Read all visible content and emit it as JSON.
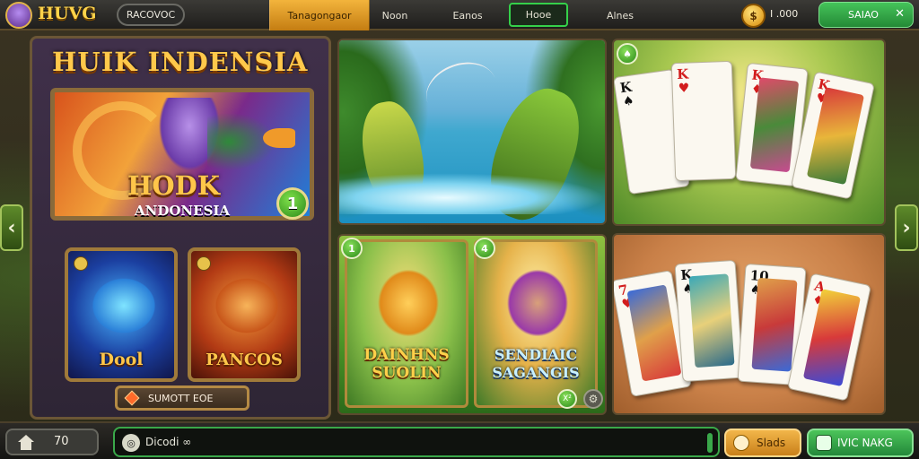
{
  "topbar": {
    "logo_text": "HUVG",
    "left_pill": "RACOVOC",
    "tabs": [
      {
        "label": "Tanagongaor",
        "active": true
      },
      {
        "label": "Noon",
        "active": false
      },
      {
        "label": "Eanos",
        "active": false
      },
      {
        "label": "Hooe",
        "active": false,
        "boxed": true
      },
      {
        "label": "Alnes",
        "active": false
      }
    ],
    "balance": "I .000",
    "deposit_label": "SAIAO",
    "close_glyph": "✕"
  },
  "nav": {
    "prev_glyph": "‹",
    "next_glyph": "›"
  },
  "left_panel": {
    "title": "HUIK INDENSIA",
    "feature_name": "HODK",
    "feature_sub": "ANDONESIA",
    "feature_badge": "1",
    "mini_cards": [
      {
        "label": "Dool",
        "theme": "blue"
      },
      {
        "label": "PANCOS",
        "theme": "red"
      }
    ],
    "select_button": "SUMOTT EOE"
  },
  "tiles": {
    "cards_top_badge": "♠",
    "cards_top": [
      {
        "rank": "K",
        "suit": "♠",
        "ink": "black"
      },
      {
        "rank": "K",
        "suit": "♥",
        "ink": "red"
      },
      {
        "rank": "K",
        "suit": "♦",
        "ink": "red"
      },
      {
        "rank": "K",
        "suit": "♥",
        "ink": "red"
      }
    ],
    "cards_bottom": [
      {
        "rank": "7",
        "suit": "♥",
        "ink": "red"
      },
      {
        "rank": "K",
        "suit": "♠",
        "ink": "black"
      },
      {
        "rank": "10",
        "suit": "♠",
        "ink": "black"
      },
      {
        "rank": "A",
        "suit": "♦",
        "ink": "red"
      }
    ],
    "subgames": [
      {
        "badge": "1",
        "title": "DAINHNS SUOLIN"
      },
      {
        "badge": "4",
        "title": "SENDIAIC SAGANGIS"
      }
    ],
    "play_badge": "X²"
  },
  "bottombar": {
    "home_count": "70",
    "chat_text": "Dicodi ∞",
    "orange_button": "Slads",
    "green_button": "IVIC NAKG"
  },
  "colors": {
    "accent_gold": "#ffc94b",
    "active_tab": "#f3b43c",
    "green_button": "#45c35a",
    "panel_border": "#6b5636"
  },
  "icons": [
    "avatar-logo",
    "coin-icon",
    "close-icon",
    "chevron-left-icon",
    "chevron-right-icon",
    "home-icon",
    "chat-icon",
    "gem-icon",
    "gear-icon"
  ]
}
